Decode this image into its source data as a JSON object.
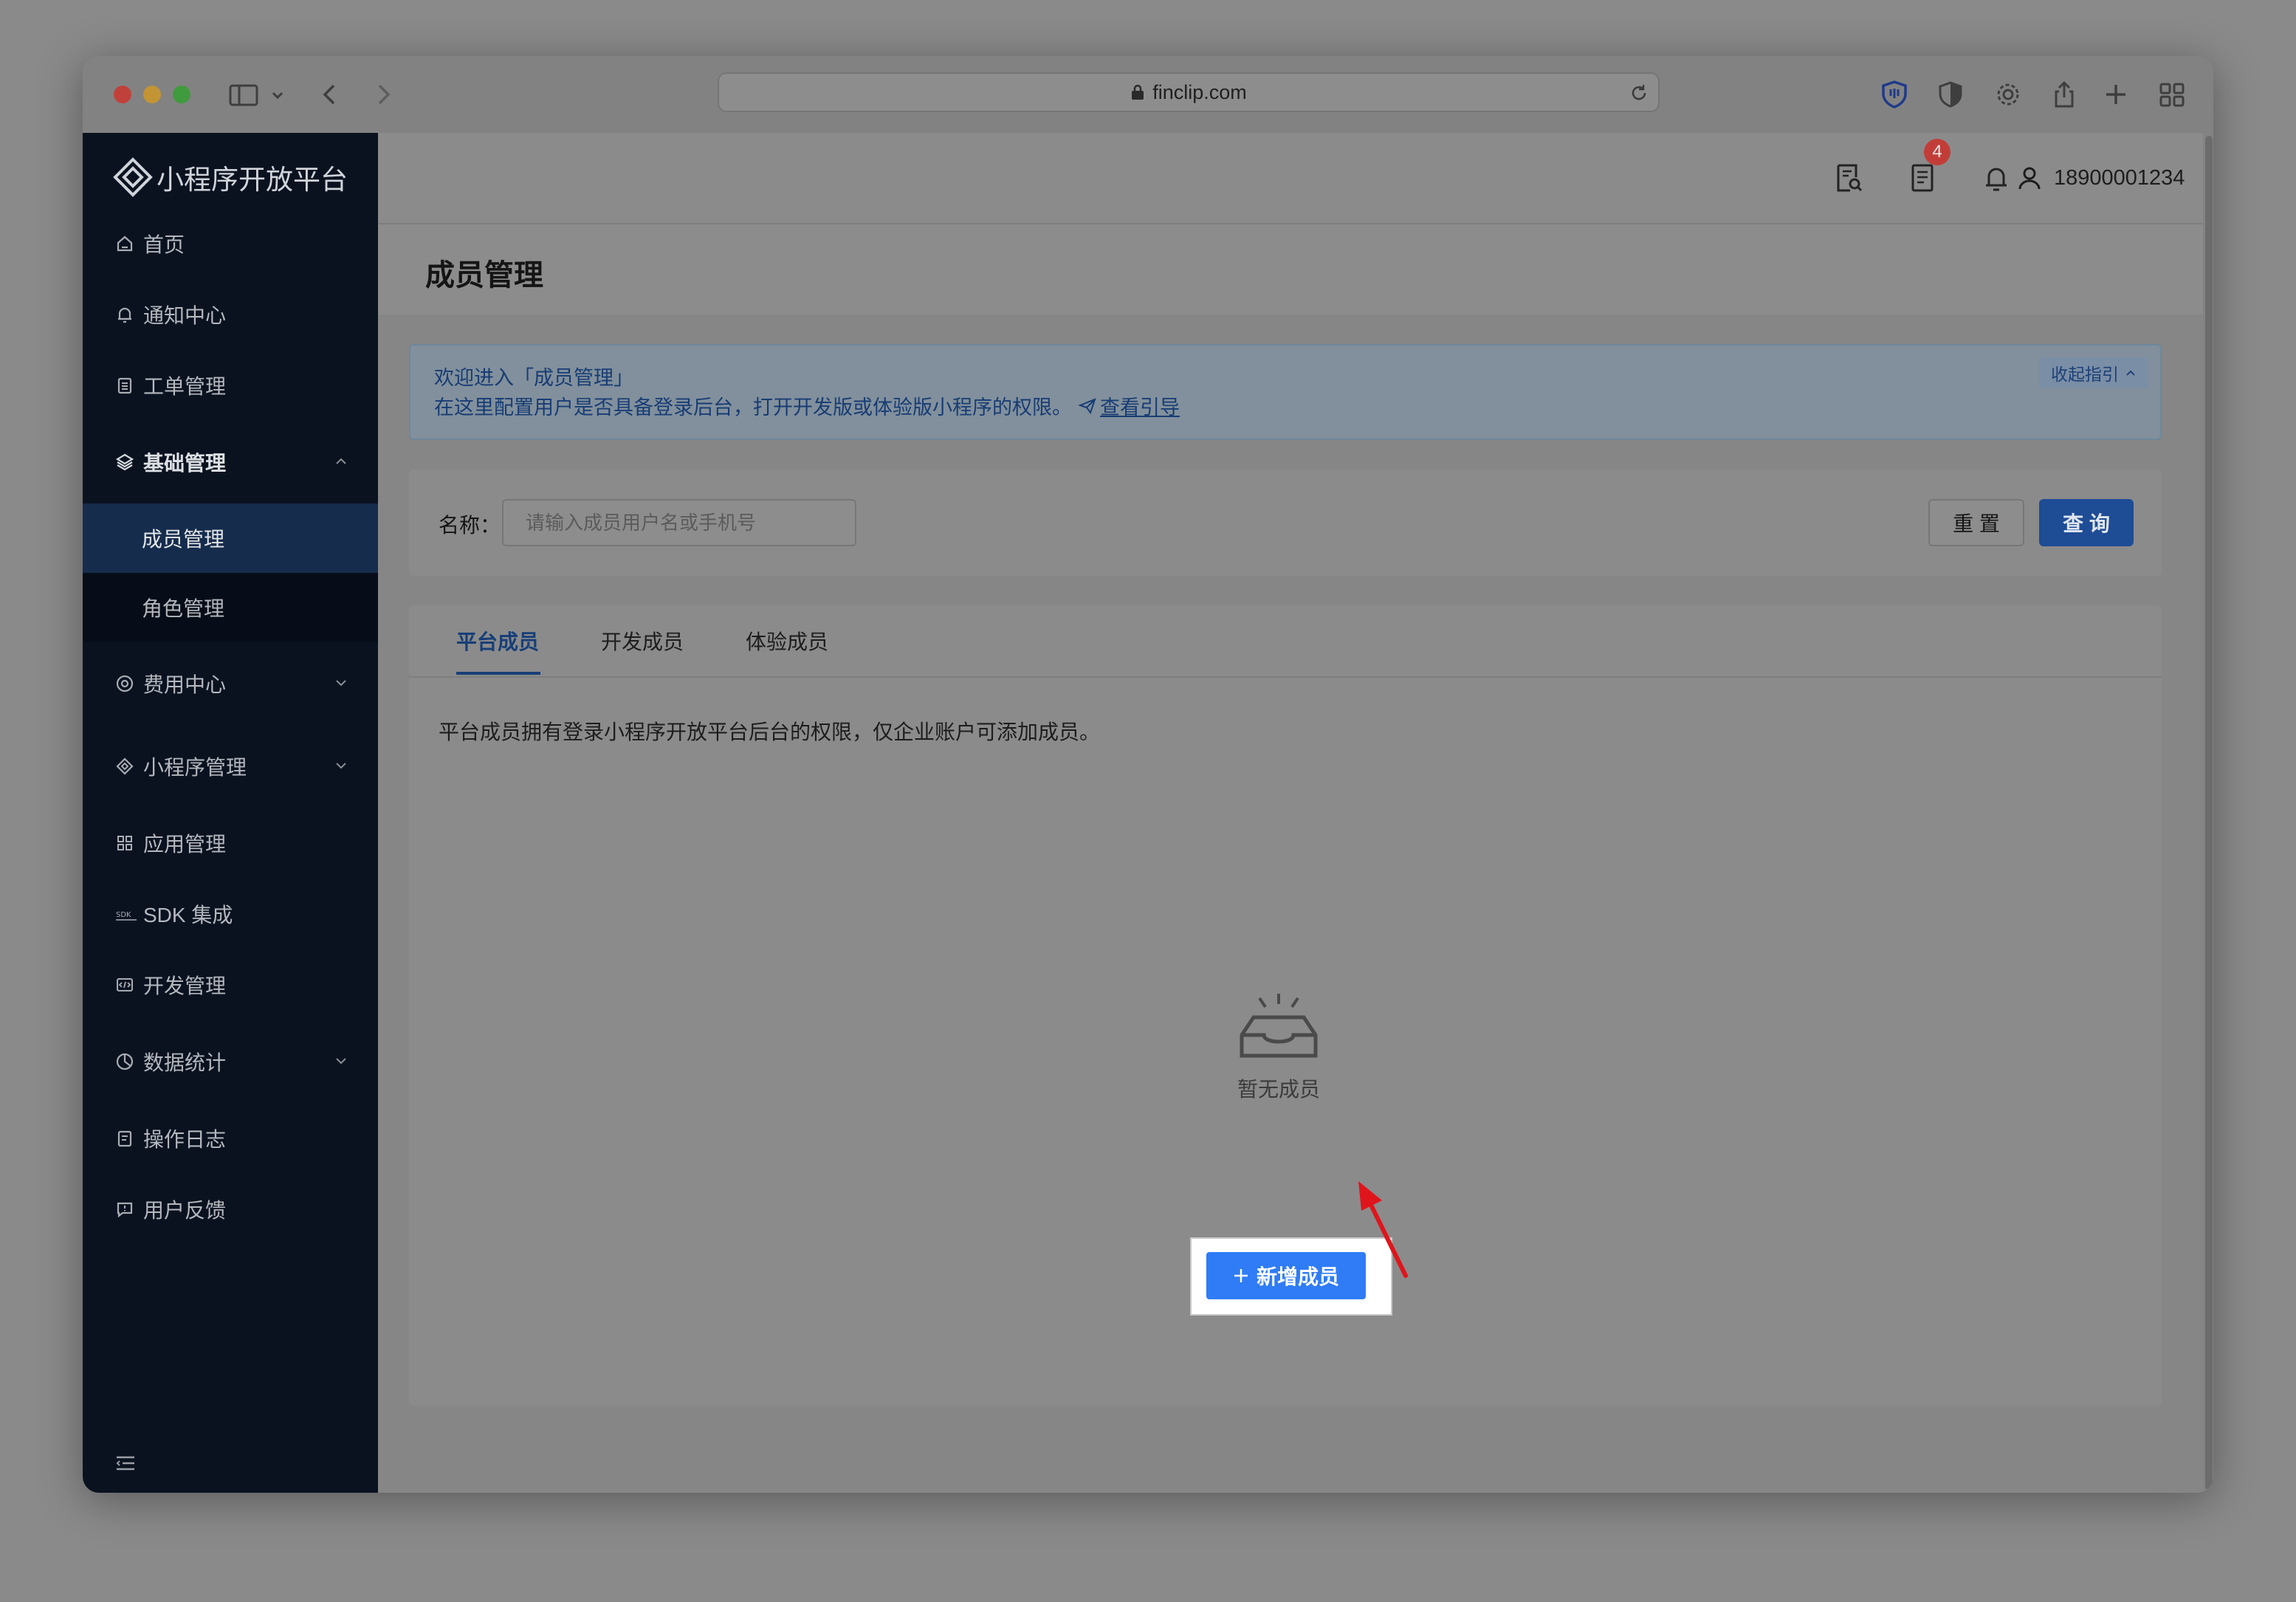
{
  "browser": {
    "url": "finclip.com"
  },
  "sidebar": {
    "logo_text": "小程序开放平台",
    "items": [
      {
        "label": "首页"
      },
      {
        "label": "通知中心"
      },
      {
        "label": "工单管理"
      },
      {
        "label": "基础管理",
        "expanded": true,
        "children": [
          {
            "label": "成员管理",
            "active": true
          },
          {
            "label": "角色管理"
          }
        ]
      },
      {
        "label": "费用中心"
      },
      {
        "label": "小程序管理"
      },
      {
        "label": "应用管理"
      },
      {
        "label": "SDK 集成"
      },
      {
        "label": "开发管理"
      },
      {
        "label": "数据统计"
      },
      {
        "label": "操作日志"
      },
      {
        "label": "用户反馈"
      }
    ]
  },
  "topbar": {
    "notification_count": "4",
    "username": "18900001234"
  },
  "page": {
    "title": "成员管理"
  },
  "banner": {
    "line1": "欢迎进入「成员管理」",
    "line2": "在这里配置用户是否具备登录后台，打开开发版或体验版小程序的权限。",
    "link_text": "查看引导",
    "collapse_label": "收起指引"
  },
  "filter": {
    "label": "名称：",
    "placeholder": "请输入成员用户名或手机号",
    "reset_label": "重 置",
    "query_label": "查 询"
  },
  "tabs": [
    {
      "label": "平台成员",
      "active": true
    },
    {
      "label": "开发成员"
    },
    {
      "label": "体验成员"
    }
  ],
  "content": {
    "description": "平台成员拥有登录小程序开放平台后台的权限，仅企业账户可添加成员。",
    "empty_text": "暂无成员",
    "add_button_label": "新增成员"
  },
  "colors": {
    "primary": "#2f7cf6",
    "sidebar_bg": "#0a1220",
    "sidebar_active": "#162c4c",
    "badge": "#c23d38",
    "annotation_arrow": "#e0151c"
  }
}
